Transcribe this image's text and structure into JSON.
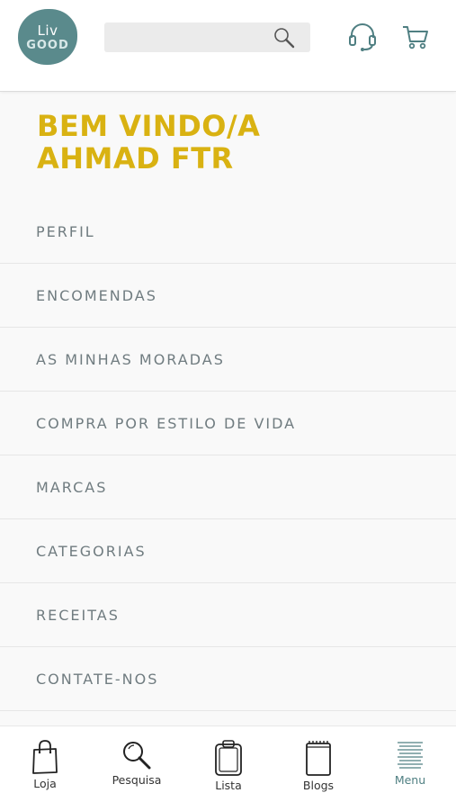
{
  "header": {
    "logo": {
      "line1": "Liv",
      "line2": "GOOD"
    },
    "search_placeholder": "",
    "icons": [
      "search-icon",
      "headset-icon",
      "cart-icon"
    ]
  },
  "welcome": {
    "line1": "BEM VINDO/A",
    "line2": "AHMAD FTR"
  },
  "menu": {
    "items": [
      {
        "label": "PERFIL"
      },
      {
        "label": "ENCOMENDAS"
      },
      {
        "label": "AS MINHAS MORADAS"
      },
      {
        "label": "COMPRA POR ESTILO DE VIDA"
      },
      {
        "label": "MARCAS"
      },
      {
        "label": "CATEGORIAS"
      },
      {
        "label": "RECEITAS"
      },
      {
        "label": "CONTATE-NOS"
      }
    ]
  },
  "bottom_nav": {
    "items": [
      {
        "label": "Loja",
        "icon": "shopping-bag-icon"
      },
      {
        "label": "Pesquisa",
        "icon": "magnifier-icon"
      },
      {
        "label": "Lista",
        "icon": "clipboard-icon"
      },
      {
        "label": "Blogs",
        "icon": "notepad-icon"
      },
      {
        "label": "Menu",
        "icon": "menu-lines-icon",
        "active": true
      }
    ]
  },
  "colors": {
    "brand": "#5a8a8c",
    "accent": "#d9b212",
    "menu_text": "#707c80"
  }
}
